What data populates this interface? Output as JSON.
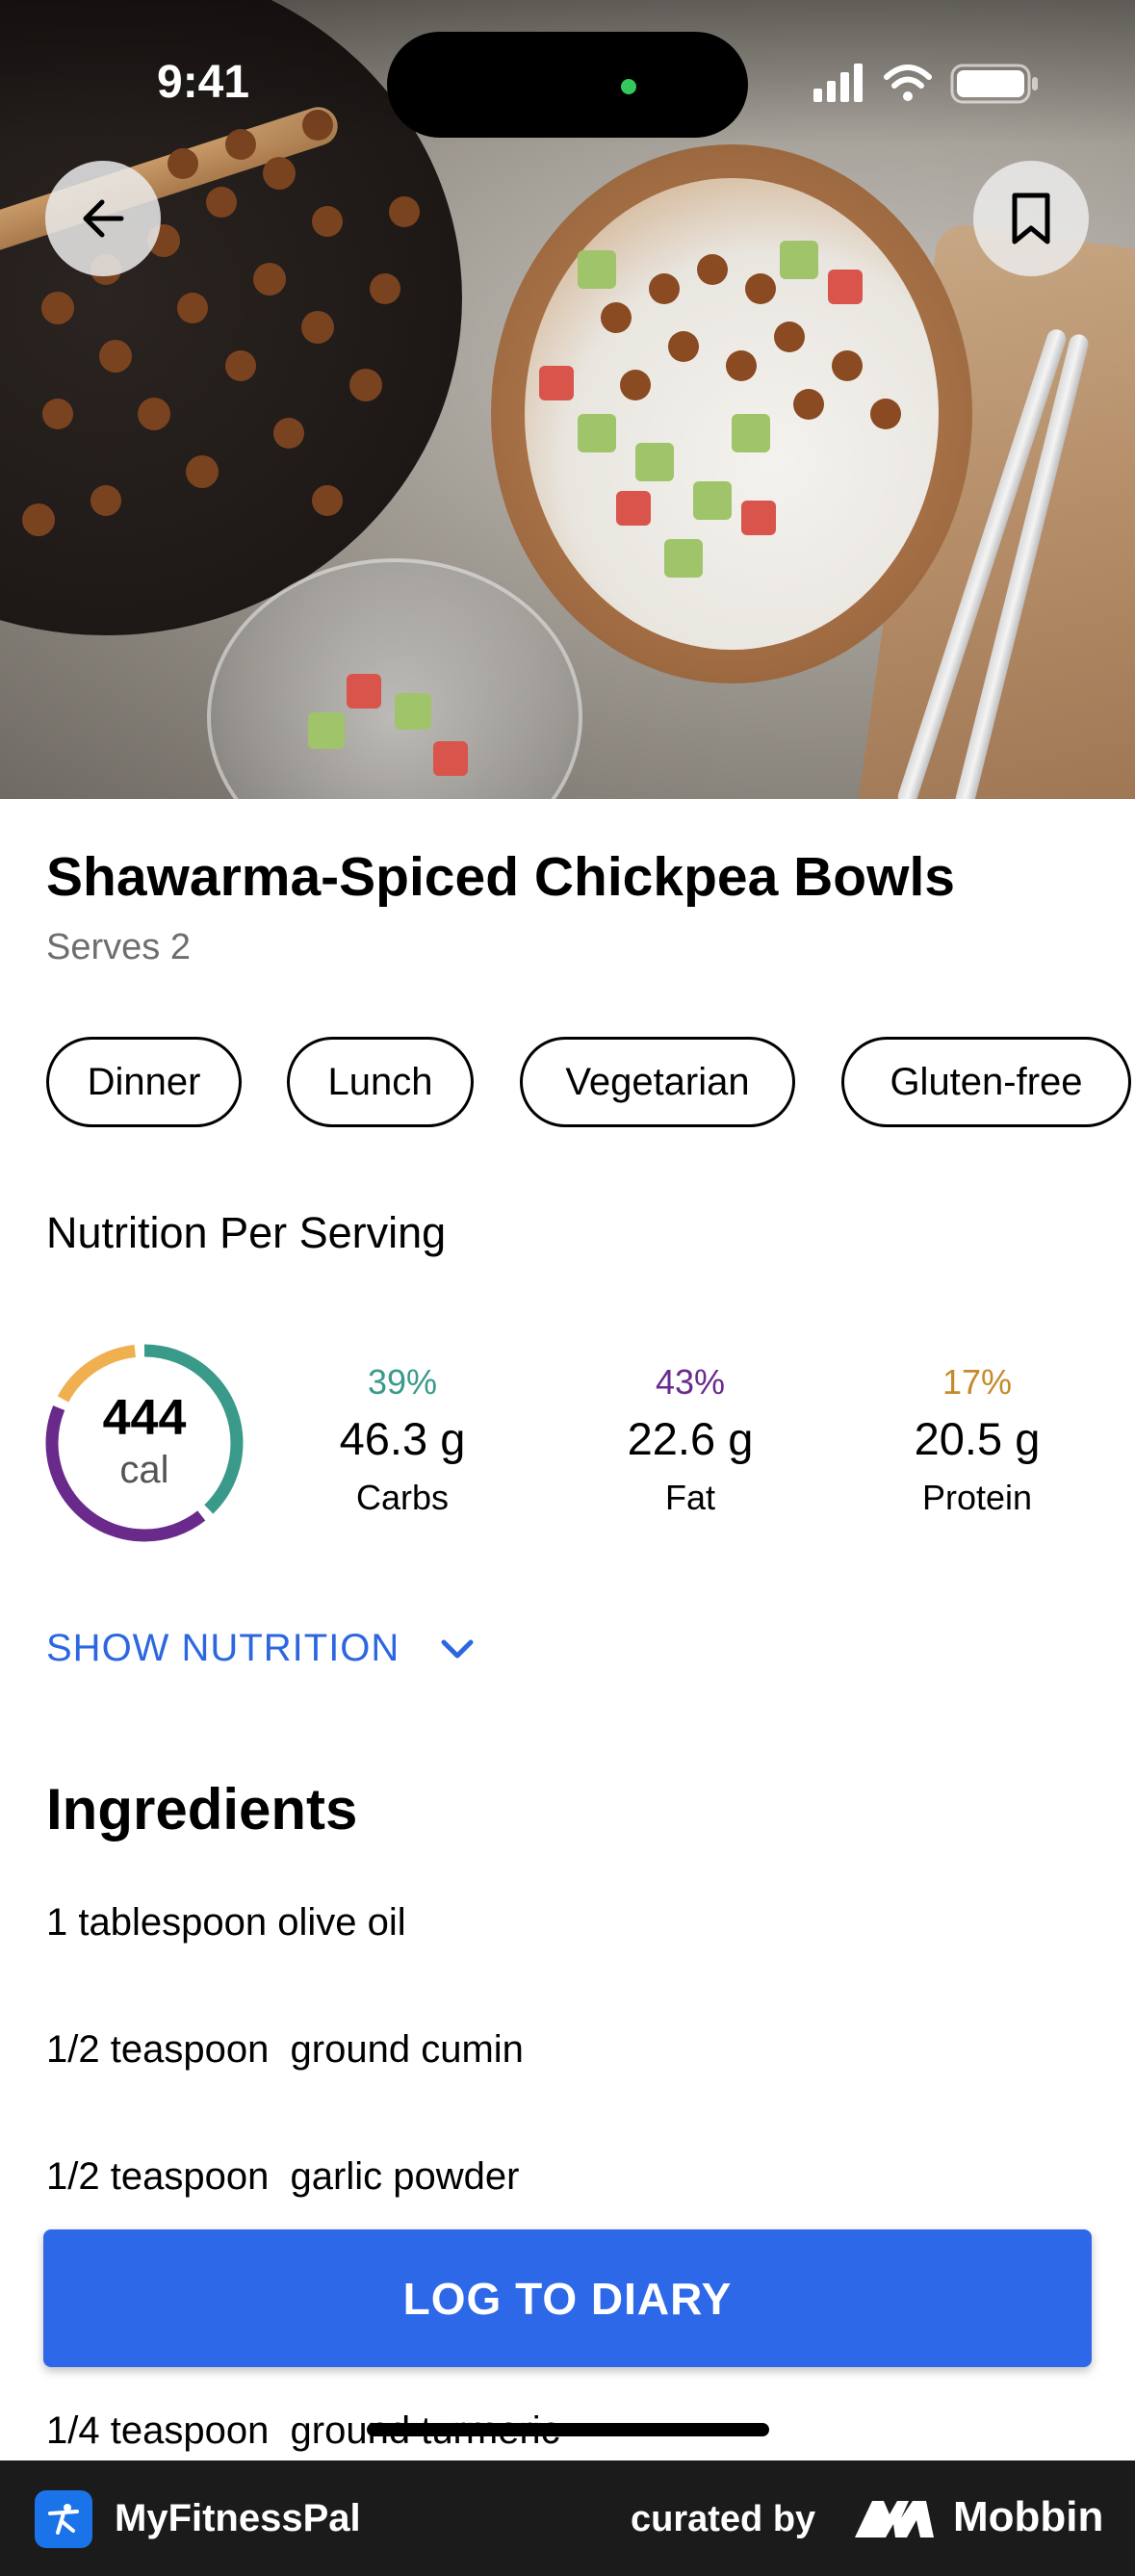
{
  "status_bar": {
    "time": "9:41"
  },
  "recipe": {
    "title": "Shawarma-Spiced Chickpea Bowls",
    "serves": "Serves 2",
    "tags": [
      "Dinner",
      "Lunch",
      "Vegetarian",
      "Gluten-free"
    ]
  },
  "nutrition": {
    "heading": "Nutrition Per Serving",
    "calories": {
      "value": "444",
      "unit": "cal"
    },
    "macros": [
      {
        "percent": "39%",
        "amount": "46.3 g",
        "label": "Carbs",
        "color": "#3a9a8a"
      },
      {
        "percent": "43%",
        "amount": "22.6 g",
        "label": "Fat",
        "color": "#6a2a8c"
      },
      {
        "percent": "17%",
        "amount": "20.5 g",
        "label": "Protein",
        "color": "#c58a2a"
      }
    ],
    "show_label": "SHOW NUTRITION"
  },
  "ingredients": {
    "heading": "Ingredients",
    "items": [
      "1 tablespoon olive oil",
      "1/2 teaspoon  ground cumin",
      "1/2 teaspoon  garlic powder",
      "1/4 teaspoon  ground turmeric"
    ]
  },
  "actions": {
    "log_label": "LOG TO DIARY"
  },
  "footer": {
    "app_name": "MyFitnessPal",
    "curated_by": "curated by",
    "brand": "Mobbin"
  },
  "colors": {
    "accent": "#2d68e8",
    "link": "#2c67e0",
    "carbs": "#3a9a8a",
    "fat": "#6a2a8c",
    "protein": "#f0b050"
  }
}
